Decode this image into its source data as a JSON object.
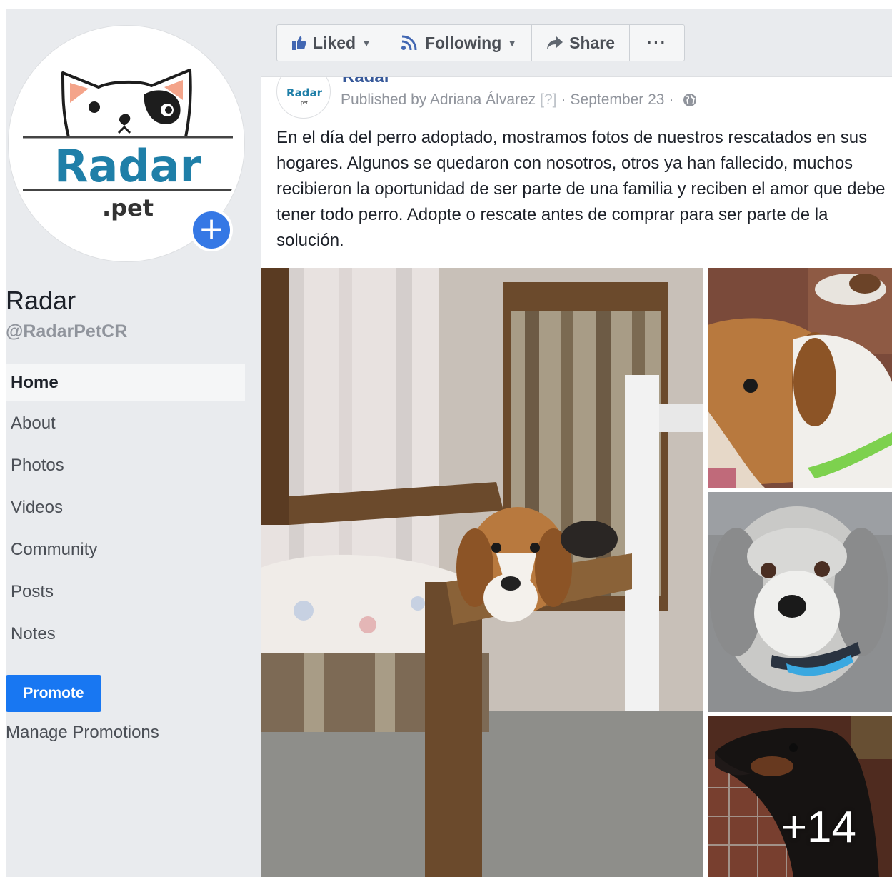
{
  "page": {
    "name": "Radar",
    "handle": "@RadarPetCR",
    "logo_text": "Radar",
    "logo_subtext": ".pet"
  },
  "nav": {
    "items": [
      {
        "label": "Home",
        "active": true
      },
      {
        "label": "About"
      },
      {
        "label": "Photos"
      },
      {
        "label": "Videos"
      },
      {
        "label": "Community"
      },
      {
        "label": "Posts"
      },
      {
        "label": "Notes"
      }
    ],
    "promote_label": "Promote",
    "manage_promotions_label": "Manage Promotions"
  },
  "actions": {
    "liked_label": "Liked",
    "following_label": "Following",
    "share_label": "Share",
    "more_label": "···"
  },
  "post": {
    "author": "Radar",
    "logo_text": "Radar",
    "logo_subtext": "pet",
    "published_by": "Published by Adriana Álvarez",
    "help_marker": "[?]",
    "date": "September 23",
    "text": "En el día del perro adoptado, mostramos fotos de nuestros rescatados en sus hogares. Algunos se quedaron con nosotros, otros ya han fallecido, muchos recibieron la oportunidad de ser parte de una familia y reciben el amor que debe tener todo perro. Adopte o rescate antes de comprar para ser parte de la solución.",
    "more_photos": "+14"
  },
  "colors": {
    "accent": "#1877f2",
    "add_button": "#3578e5",
    "logo_blue": "#1f7fa8",
    "sidebar_bg": "#e9ebee"
  }
}
